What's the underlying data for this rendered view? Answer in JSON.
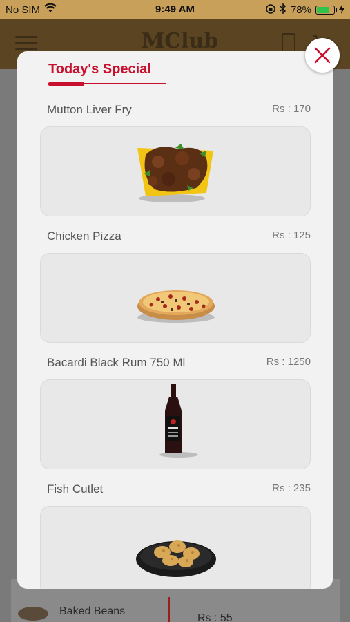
{
  "status_bar": {
    "carrier": "No SIM",
    "time": "9:49 AM",
    "battery_percent": "78%",
    "battery_level": 0.78
  },
  "header": {
    "logo_text": "MClub",
    "menu_icon": "hamburger-icon",
    "doc_icon": "document-icon",
    "cart_icon": "cart-icon"
  },
  "modal": {
    "title": "Today's Special",
    "accent_color": "#c8102e",
    "close_icon": "close-icon",
    "items": [
      {
        "name": "Mutton Liver Fry",
        "price": "Rs : 170",
        "image": "mutton-liver-fry-image"
      },
      {
        "name": "Chicken Pizza",
        "price": "Rs : 125",
        "image": "chicken-pizza-image"
      },
      {
        "name": "Bacardi Black Rum 750 Ml",
        "price": "Rs : 1250",
        "image": "rum-bottle-image"
      },
      {
        "name": "Fish Cutlet",
        "price": "Rs : 235",
        "image": "fish-cutlet-image"
      }
    ]
  },
  "background_list": {
    "item_name": "Baked Beans",
    "item_price": "Rs : 55"
  }
}
